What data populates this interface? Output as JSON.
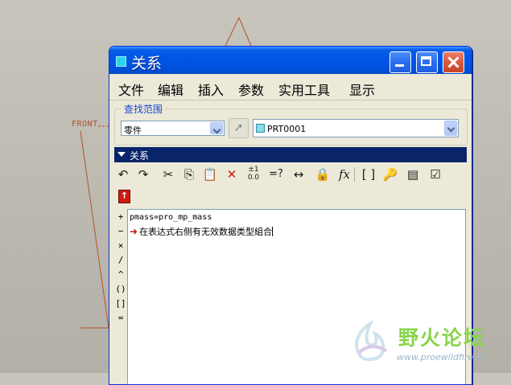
{
  "background": {
    "front_label": "FRONT"
  },
  "window": {
    "title": "关系",
    "title_icon": "app-icon"
  },
  "menu": [
    "文件",
    "编辑",
    "插入",
    "参数",
    "实用工具",
    "显示"
  ],
  "search_scope": {
    "group_label": "查找范围",
    "type_value": "零件",
    "model_value": "PRT0001"
  },
  "relations_section": {
    "label": "关系"
  },
  "toolbar": {
    "icons": [
      "undo-icon",
      "redo-icon",
      "cut-icon",
      "copy-icon",
      "paste-icon",
      "delete-icon",
      "sort-icon",
      "evaluate-icon",
      "measure-icon",
      "verify-icon",
      "function-icon",
      "parameter-icon",
      "show-values-icon",
      "units-icon",
      "check-icon"
    ]
  },
  "operators": [
    "+",
    "−",
    "×",
    "/",
    "^",
    "()",
    "[]",
    "="
  ],
  "editor": {
    "lines": [
      "pmass=pro_mp_mass"
    ],
    "error_message": "在表达式右侧有无效数据类型組合"
  },
  "watermark": {
    "title": "野火论坛",
    "url": "www.proewildfire.cn"
  },
  "colors": {
    "titlebar": "#0054e3",
    "section_bar": "#0a246a",
    "error_arrow": "#c0150a",
    "window_bg": "#ece9d8"
  }
}
